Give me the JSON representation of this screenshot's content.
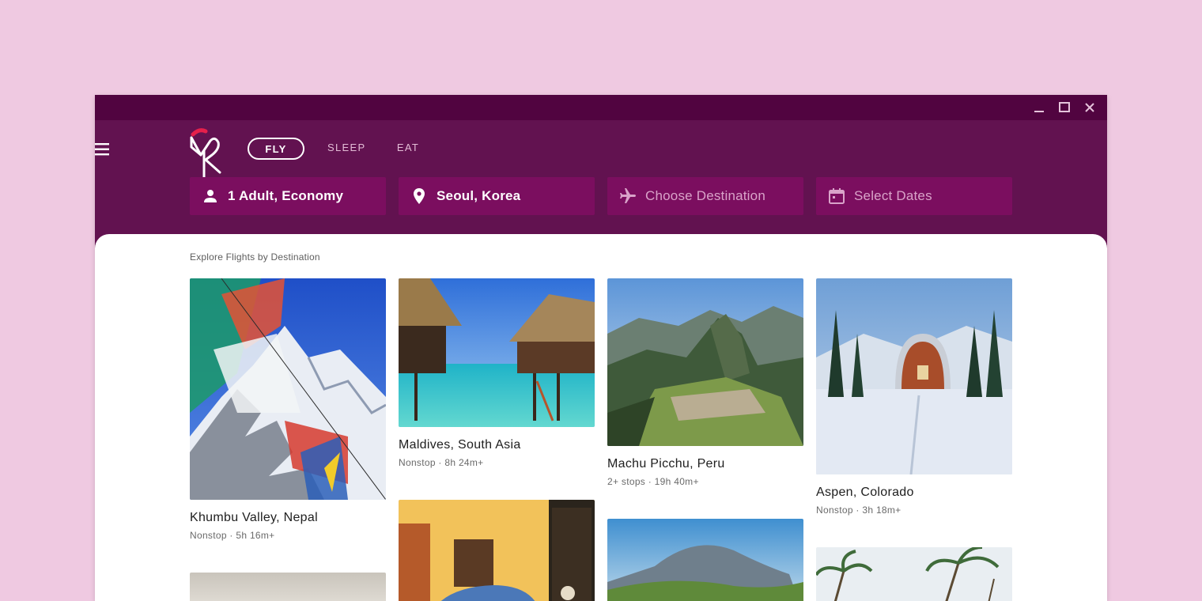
{
  "window_controls": {
    "minimize_icon": "minimize-icon",
    "maximize_icon": "maximize-icon",
    "close_icon": "close-icon"
  },
  "header": {
    "menu_icon": "hamburger-menu-icon",
    "logo_icon": "bird-logo-icon",
    "tabs": [
      {
        "label": "FLY",
        "active": true
      },
      {
        "label": "SLEEP",
        "active": false
      },
      {
        "label": "EAT",
        "active": false
      }
    ],
    "search": {
      "travelers": {
        "value": "1 Adult, Economy",
        "icon": "person-icon"
      },
      "origin": {
        "value": "Seoul, Korea",
        "icon": "location-pin-icon"
      },
      "destination": {
        "placeholder": "Choose Destination",
        "icon": "airplane-icon"
      },
      "dates": {
        "placeholder": "Select Dates",
        "icon": "calendar-icon"
      }
    }
  },
  "explore": {
    "title": "Explore Flights by Destination",
    "destinations": [
      {
        "name": "Khumbu Valley, Nepal",
        "meta": "Nonstop · 5h 16m+"
      },
      {
        "name": "Maldives, South Asia",
        "meta": "Nonstop · 8h 24m+"
      },
      {
        "name": "Machu Picchu, Peru",
        "meta": "2+ stops · 19h 40m+"
      },
      {
        "name": "Aspen, Colorado",
        "meta": "Nonstop · 3h 18m+"
      }
    ]
  },
  "colors": {
    "page_bg": "#efc9e1",
    "titlebar": "#510440",
    "header": "#621250",
    "field_bg": "#7b0e5f",
    "logo_accent": "#e5204b"
  }
}
